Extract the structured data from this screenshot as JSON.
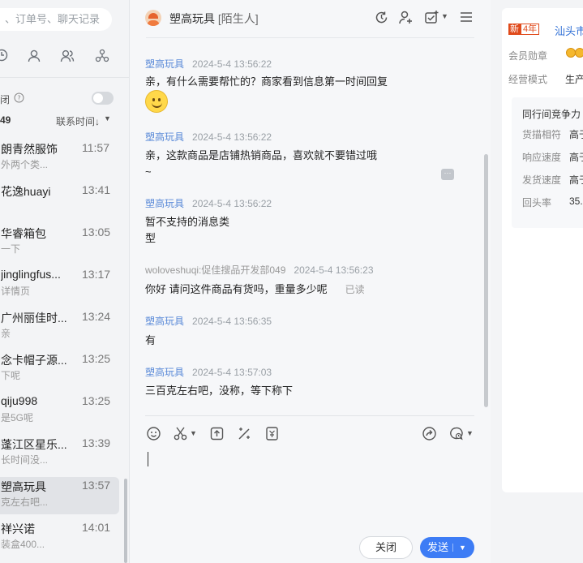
{
  "left": {
    "search_placeholder": "、订单号、聊天记录",
    "unread_label": "闭",
    "count_label": "49",
    "sort_label": "联系时间↓",
    "items": [
      {
        "name": "朗青然服饰",
        "time": "11:57",
        "snippet": "外两个类..."
      },
      {
        "name": "花逸huayi",
        "time": "13:41",
        "snippet": ""
      },
      {
        "name": "华睿箱包",
        "time": "13:05",
        "snippet": "一下"
      },
      {
        "name": "jinglingfus...",
        "time": "13:17",
        "snippet": "详情页"
      },
      {
        "name": "广州丽佳时...",
        "time": "13:24",
        "snippet": "亲"
      },
      {
        "name": "念卡帽子源...",
        "time": "13:25",
        "snippet": "下呢"
      },
      {
        "name": "qiju998",
        "time": "13:25",
        "snippet": "是5G呢"
      },
      {
        "name": "蓬江区星乐...",
        "time": "13:39",
        "snippet": "长时间没..."
      },
      {
        "name": "塑高玩具",
        "time": "13:57",
        "snippet": "克左右吧..."
      },
      {
        "name": "祥兴诺",
        "time": "14:01",
        "snippet": "装盒400..."
      }
    ]
  },
  "chat": {
    "title": "塑高玩具",
    "tag": "[陌生人]",
    "messages": [
      {
        "sender": "塑高玩具",
        "time": "2024-5-4 13:56:22",
        "text": "亲，有什么需要帮忙的？商家看到信息第一时间回复"
      },
      {
        "sender": "塑高玩具",
        "time": "2024-5-4 13:56:22",
        "text": "亲，这款商品是店铺热销商品，喜欢就不要错过哦",
        "text2": "~"
      },
      {
        "sender": "塑高玩具",
        "time": "2024-5-4 13:56:22",
        "text": "暂不支持的消息类",
        "text2": "型"
      },
      {
        "sender": "woloveshuqi:促佳搜品开发部049",
        "time": "2024-5-4 13:56:23",
        "text": "你好 请问这件商品有货吗，重量多少呢",
        "read": "已读"
      },
      {
        "sender": "塑高玩具",
        "time": "2024-5-4 13:56:35",
        "text": "有"
      },
      {
        "sender": "塑高玩具",
        "time": "2024-5-4 13:57:03",
        "text": "三百克左右吧，没称，等下称下"
      }
    ],
    "close_label": "关闭",
    "send_label": "发送"
  },
  "right": {
    "badge_a": "新",
    "badge_b": "4年",
    "company": "汕头市",
    "rows": [
      {
        "label": "会员勋章",
        "value": ""
      },
      {
        "label": "经营模式",
        "value": "生产"
      }
    ],
    "compete_title": "同行间竞争力",
    "compete_rows": [
      {
        "label": "货描相符",
        "value": "高于"
      },
      {
        "label": "响应速度",
        "value": "高于"
      },
      {
        "label": "发货速度",
        "value": "高于"
      },
      {
        "label": "回头率",
        "value": "35."
      }
    ]
  }
}
